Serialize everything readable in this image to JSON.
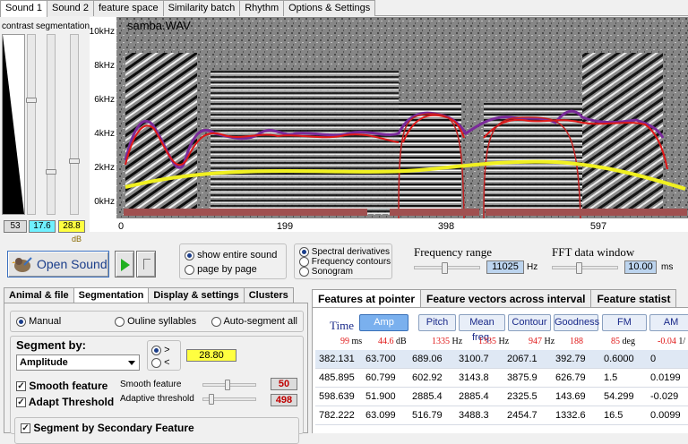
{
  "tabs": [
    {
      "label": "Sound 1",
      "active": true
    },
    {
      "label": "Sound 2",
      "active": false
    },
    {
      "label": "feature space",
      "active": false
    },
    {
      "label": "Similarity batch",
      "active": false
    },
    {
      "label": "Rhythm",
      "active": false
    },
    {
      "label": "Options & Settings",
      "active": false
    }
  ],
  "left_panel": {
    "contrast_label": "contrast",
    "segmentation_label": "segmentation",
    "values": [
      "53",
      "17.6",
      "28.8"
    ],
    "value_colors": [
      "#dcdcdc",
      "#6ff0ff",
      "#ffff40"
    ],
    "unit": "dB"
  },
  "spectrogram": {
    "file_name": "samba.WAV",
    "y_ticks": [
      "10kHz",
      "8kHz",
      "6kHz",
      "4kHz",
      "2kHz",
      "0kHz"
    ],
    "x_ticks": [
      "0",
      "199",
      "398",
      "597"
    ]
  },
  "open_sound": {
    "label": "Open Sound"
  },
  "view_options": [
    {
      "label": "show entire sound",
      "selected": true
    },
    {
      "label": "page by page",
      "selected": false
    }
  ],
  "display_modes": [
    {
      "label": "Spectral derivatives",
      "selected": true
    },
    {
      "label": "Frequency contours",
      "selected": false
    },
    {
      "label": "Sonogram",
      "selected": false
    }
  ],
  "frequency_range": {
    "label": "Frequency range",
    "value": "11025",
    "unit": "Hz"
  },
  "fft_window": {
    "label": "FFT data window",
    "value": "10.00",
    "unit": "ms"
  },
  "sub_tabs": [
    {
      "label": "Animal & file",
      "active": false
    },
    {
      "label": "Segmentation",
      "active": true
    },
    {
      "label": "Display & settings",
      "active": false
    },
    {
      "label": "Clusters",
      "active": false
    }
  ],
  "segmentation": {
    "modes": [
      {
        "label": "Manual",
        "selected": true
      },
      {
        "label": "Ouline syllables",
        "selected": false
      },
      {
        "label": "Auto-segment all",
        "selected": false
      }
    ],
    "segment_by_label": "Segment by:",
    "segment_by_value": "Amplitude",
    "gt_label": ">",
    "lt_label": "<",
    "threshold_value": "28.80",
    "smooth_feature_label": "Smooth feature",
    "adapt_threshold_label": "Adapt Threshold",
    "smooth_feature_slider_label": "Smooth feature",
    "smooth_feature_value": "50",
    "adaptive_threshold_label": "Adaptive threshold",
    "adaptive_threshold_value": "498",
    "secondary_label": "Segment by Secondary Feature"
  },
  "features": {
    "tabs": [
      {
        "label": "Features at pointer",
        "active": true
      },
      {
        "label": "Feature vectors across interval",
        "active": false
      },
      {
        "label": "Feature statist",
        "active": false
      }
    ],
    "time_label": "Time",
    "columns": [
      "Amp",
      "Pitch",
      "Mean freq.",
      "Contour",
      "Goodness",
      "FM",
      "AM"
    ],
    "pointer_values": [
      {
        "value": "99",
        "unit": "ms"
      },
      {
        "value": "44.6",
        "unit": "dB"
      },
      {
        "value": "1335",
        "unit": "Hz"
      },
      {
        "value": "1335",
        "unit": "Hz"
      },
      {
        "value": "947",
        "unit": "Hz"
      },
      {
        "value": "188",
        "unit": ""
      },
      {
        "value": "85",
        "unit": "deg"
      },
      {
        "value": "-0.04",
        "unit": "1/"
      }
    ],
    "rows": [
      [
        "382.131",
        "63.700",
        "689.06",
        "3100.7",
        "2067.1",
        "392.79",
        "0.6000",
        "0"
      ],
      [
        "485.895",
        "60.799",
        "602.92",
        "3143.8",
        "3875.9",
        "626.79",
        "1.5",
        "0.0199"
      ],
      [
        "598.639",
        "51.900",
        "2885.4",
        "2885.4",
        "2325.5",
        "143.69",
        "54.299",
        "-0.029"
      ],
      [
        "782.222",
        "63.099",
        "516.79",
        "3488.3",
        "2454.7",
        "1332.6",
        "16.5",
        "0.0099"
      ]
    ]
  }
}
